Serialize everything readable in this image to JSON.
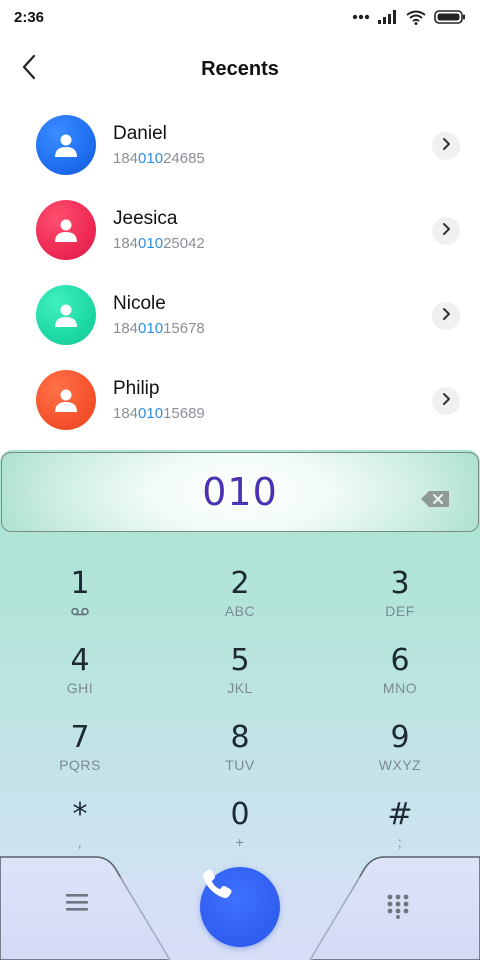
{
  "status_bar": {
    "time": "2:36",
    "icons": [
      "more-dots-icon",
      "signal-icon",
      "wifi-icon",
      "battery-icon"
    ]
  },
  "header": {
    "title": "Recents",
    "back_icon": "chevron-left-icon"
  },
  "contacts": [
    {
      "name": "Daniel",
      "number_prefix": "184",
      "number_match": "010",
      "number_suffix": "24685",
      "avatar_color": "#1e6ff0"
    },
    {
      "name": "Jeesica",
      "number_prefix": "184",
      "number_match": "010",
      "number_suffix": "25042",
      "avatar_color": "#ee2a55"
    },
    {
      "name": "Nicole",
      "number_prefix": "184",
      "number_match": "010",
      "number_suffix": "15678",
      "avatar_color": "#1ed9a5"
    },
    {
      "name": "Philip",
      "number_prefix": "184",
      "number_match": "010",
      "number_suffix": "15689",
      "avatar_color": "#f5532d"
    }
  ],
  "dialer": {
    "dialed_number": "010",
    "keys": [
      {
        "digit": "1",
        "letters": ""
      },
      {
        "digit": "2",
        "letters": "ABC"
      },
      {
        "digit": "3",
        "letters": "DEF"
      },
      {
        "digit": "4",
        "letters": "GHI"
      },
      {
        "digit": "5",
        "letters": "JKL"
      },
      {
        "digit": "6",
        "letters": "MNO"
      },
      {
        "digit": "7",
        "letters": "PQRS"
      },
      {
        "digit": "8",
        "letters": "TUV"
      },
      {
        "digit": "9",
        "letters": "WXYZ"
      },
      {
        "digit": "*",
        "letters": ","
      },
      {
        "digit": "0",
        "letters": "+"
      },
      {
        "digit": "#",
        "letters": ";"
      }
    ]
  },
  "colors": {
    "accent_blue": "#2a8fe0",
    "dialed_text": "#4b32b0",
    "call_button": "#2f5ef0"
  }
}
